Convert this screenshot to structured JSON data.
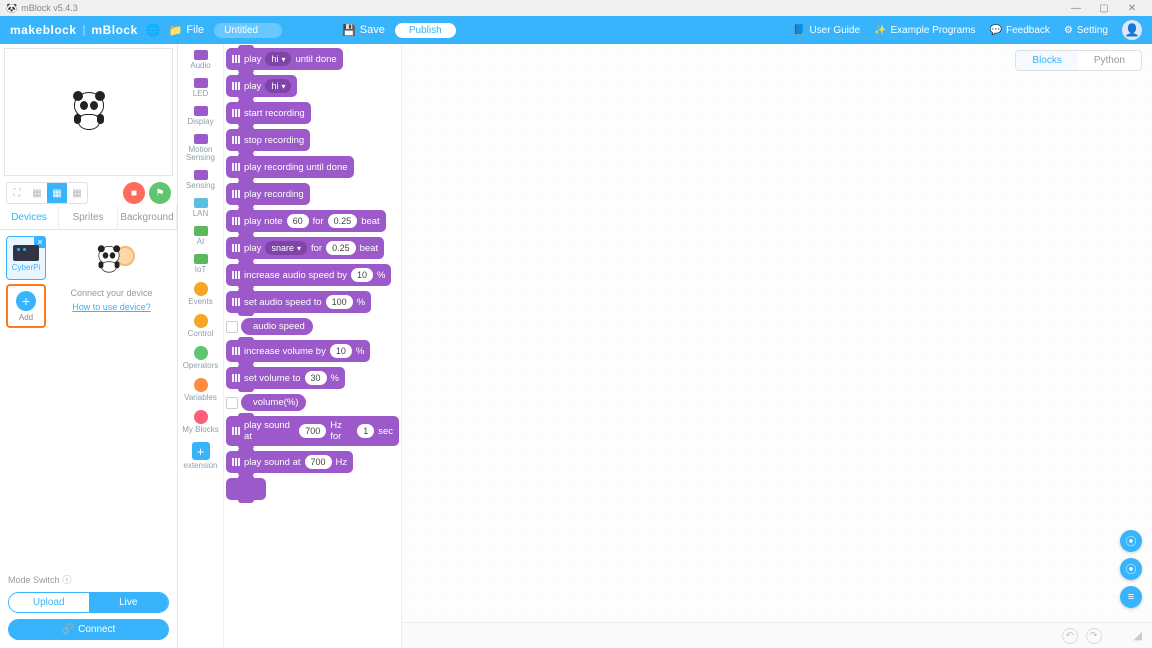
{
  "window": {
    "title": "mBlock v5.4.3"
  },
  "topbar": {
    "brand1": "makeblock",
    "sep": "|",
    "brand2": "mBlock",
    "file": "File",
    "untitled": "Untitled",
    "save": "Save",
    "publish": "Publish",
    "user_guide": "User Guide",
    "example": "Example Programs",
    "feedback": "Feedback",
    "setting": "Setting"
  },
  "tabs": {
    "devices": "Devices",
    "sprites": "Sprites",
    "background": "Background"
  },
  "device": {
    "name": "CyberPi",
    "add": "Add",
    "connect_hint": "Connect your device",
    "howto": "How to use device?",
    "mode_switch": "Mode Switch",
    "upload": "Upload",
    "live": "Live",
    "connect": "Connect"
  },
  "categories": [
    {
      "label": "Audio",
      "color": "#9b59c9",
      "shape": "sq"
    },
    {
      "label": "LED",
      "color": "#9b59c9",
      "shape": "sq"
    },
    {
      "label": "Display",
      "color": "#9b59c9",
      "shape": "sq"
    },
    {
      "label": "Motion Sensing",
      "color": "#9b59c9",
      "shape": "sq"
    },
    {
      "label": "Sensing",
      "color": "#9b59c9",
      "shape": "sq"
    },
    {
      "label": "LAN",
      "color": "#5bc0de",
      "shape": "sq"
    },
    {
      "label": "AI",
      "color": "#5cb85c",
      "shape": "sq"
    },
    {
      "label": "IoT",
      "color": "#5cb85c",
      "shape": "sq"
    },
    {
      "label": "Events",
      "color": "#f5a623",
      "shape": "dot"
    },
    {
      "label": "Control",
      "color": "#f5a623",
      "shape": "dot"
    },
    {
      "label": "Operators",
      "color": "#5fc56e",
      "shape": "dot"
    },
    {
      "label": "Variables",
      "color": "#ff8c42",
      "shape": "dot"
    },
    {
      "label": "My Blocks",
      "color": "#ff5e7a",
      "shape": "dot"
    },
    {
      "label": "extension",
      "color": "#37b4fc",
      "shape": "ext"
    }
  ],
  "blocks": {
    "play_until": {
      "pre": "play",
      "opt": "hi",
      "post": "until done"
    },
    "play": {
      "pre": "play",
      "opt": "hi"
    },
    "start_rec": "start recording",
    "stop_rec": "stop recording",
    "play_rec_until": "play recording until done",
    "play_rec": "play recording",
    "play_note": {
      "a": "play note",
      "n1": "60",
      "b": "for",
      "n2": "0.25",
      "c": "beat"
    },
    "play_drum": {
      "a": "play",
      "opt": "snare",
      "b": "for",
      "n1": "0.25",
      "c": "beat"
    },
    "inc_speed": {
      "a": "increase audio speed by",
      "n1": "10",
      "b": "%"
    },
    "set_speed": {
      "a": "set audio speed to",
      "n1": "100",
      "b": "%"
    },
    "rep_speed": "audio speed",
    "inc_vol": {
      "a": "increase volume by",
      "n1": "10",
      "b": "%"
    },
    "set_vol": {
      "a": "set volume to",
      "n1": "30",
      "b": "%"
    },
    "rep_vol": "volume(%)",
    "play_hz_for": {
      "a": "play sound at",
      "n1": "700",
      "b": "Hz for",
      "n2": "1",
      "c": "sec"
    },
    "play_hz": {
      "a": "play sound at",
      "n1": "700",
      "b": "Hz"
    }
  },
  "code_toggle": {
    "blocks": "Blocks",
    "python": "Python"
  }
}
